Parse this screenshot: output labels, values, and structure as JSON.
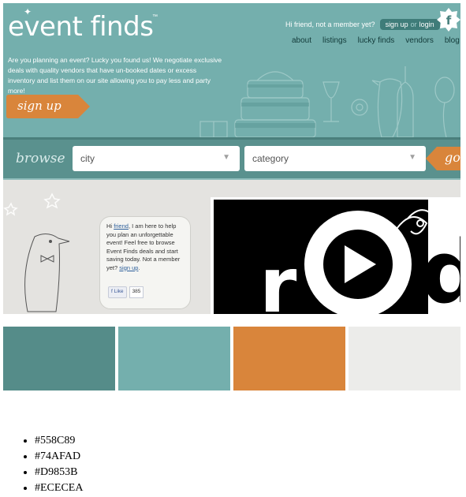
{
  "site": {
    "logo": "event finds",
    "logo_tm": "™",
    "member_prompt": "Hi friend, not a member yet?",
    "signup_link": "sign up",
    "or_text": "or",
    "login_link": "login",
    "facebook_letter": "f",
    "nav": [
      "about",
      "listings",
      "lucky finds",
      "vendors",
      "blog"
    ],
    "intro_text": "Are you planning an event? Lucky you found us! We negotiate exclusive deals with quality vendors that have un-booked dates or excess inventory and list them on our site allowing you to pay less and party more!",
    "signup_button": "sign up"
  },
  "browse": {
    "label": "browse",
    "city_placeholder": "city",
    "category_placeholder": "category",
    "go_button": "go"
  },
  "penguin_bubble": {
    "greeting": "Hi",
    "friend_link": "friend",
    "body": "I am here to help you plan an unforgettable event! Feel free to browse Event Finds deals and start saving today. Not a member yet?",
    "signup_link": "sign up",
    "like_label": "Like",
    "like_count": "385"
  },
  "video": {
    "letters_left": "r",
    "letters_right": "d"
  },
  "palette": {
    "colors": [
      "#558C89",
      "#74AFAD",
      "#D9853B",
      "#ECECEA"
    ],
    "labels": [
      "#558C89",
      "#74AFAD",
      "#D9853B",
      "#ECECEA"
    ]
  }
}
